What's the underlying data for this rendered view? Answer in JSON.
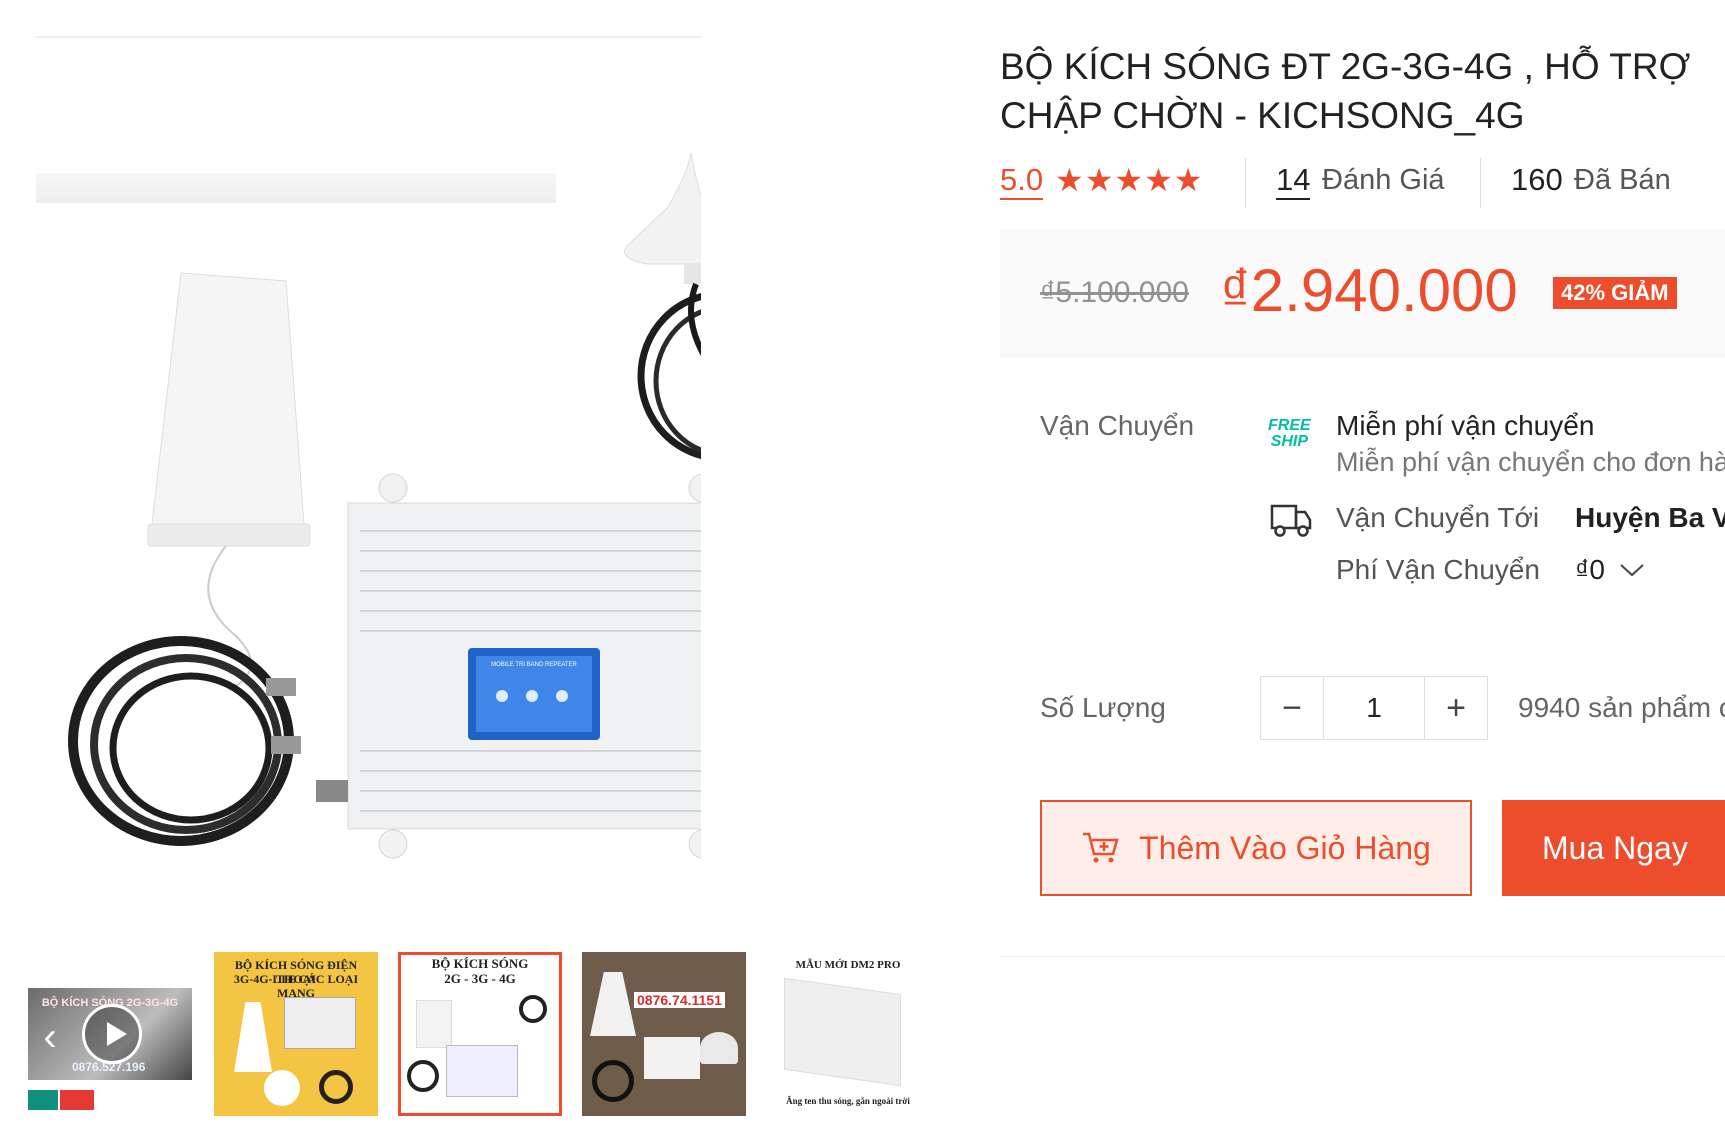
{
  "product": {
    "title_line1": "BỘ KÍCH SÓNG ĐT 2G-3G-4G , HỖ TRỢ",
    "title_line2": "CHẬP CHỜN - KICHSONG_4G",
    "rating": "5.0",
    "stars": "★★★★★",
    "review_count": "14",
    "review_label": "Đánh Giá",
    "sold_count": "160",
    "sold_label": "Đã Bán"
  },
  "price": {
    "original": "₫5.100.000",
    "current": "₫2.940.000",
    "discount": "42% GIẢM"
  },
  "shipping": {
    "label": "Vận Chuyển",
    "freeship_line1": "FREE",
    "freeship_line2": "SHIP",
    "title": "Miễn phí vận chuyển",
    "subtitle": "Miễn phí vận chuyển cho đơn hà",
    "to_label": "Vận Chuyển Tới",
    "to_value": "Huyện Ba V",
    "fee_label": "Phí Vận Chuyển",
    "fee_value": "₫0"
  },
  "quantity": {
    "label": "Số Lượng",
    "minus": "−",
    "plus": "+",
    "value": "1",
    "stock": "9940 sản phẩm c"
  },
  "actions": {
    "add_to_cart": "Thêm Vào Giỏ Hàng",
    "buy_now": "Mua Ngay"
  },
  "thumbnails": [
    {
      "caption": "BỘ KÍCH SÓNG 2G-3G-4G",
      "phone": "0876.527.196"
    },
    {
      "caption_line1": "BỘ KÍCH SÓNG ĐIỆN THOẠI",
      "caption_line2": "3G-4G-LTE CÁC LOẠI MẠNG"
    },
    {
      "caption_line1": "BỘ KÍCH SÓNG",
      "caption_line2": "2G - 3G - 4G"
    },
    {
      "phone": "0876.74.1151"
    },
    {
      "caption": "MẪU MỚI DM2 PRO",
      "footer": "Ăng ten thu sóng, gắn ngoài trời"
    }
  ],
  "image_panel": {
    "label": "MOBILE TRI BAND REPEATER"
  },
  "colors": {
    "accent": "#ee4d2d",
    "freeship": "#00bfa5"
  }
}
